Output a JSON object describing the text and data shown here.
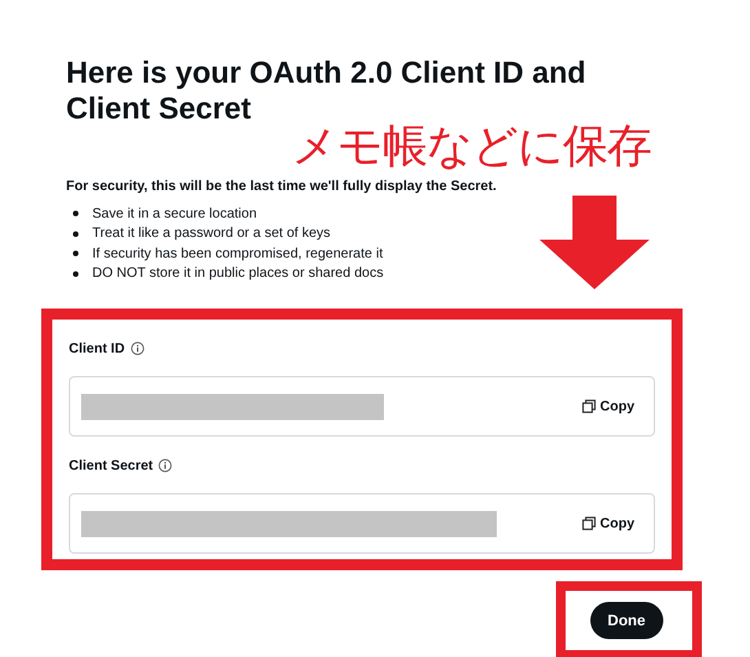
{
  "title": "Here is your OAuth 2.0 Client ID and Client Secret",
  "annotation": {
    "note": "メモ帳などに保存"
  },
  "notice": "For security, this will be the last time we'll fully display the Secret.",
  "tips": [
    "Save it in a secure location",
    "Treat it like a password or a set of keys",
    "If security has been compromised, regenerate it",
    "DO NOT store it in public places or shared docs"
  ],
  "fields": [
    {
      "label": "Client ID",
      "copy": "Copy"
    },
    {
      "label": "Client Secret",
      "copy": "Copy"
    }
  ],
  "done": "Done"
}
